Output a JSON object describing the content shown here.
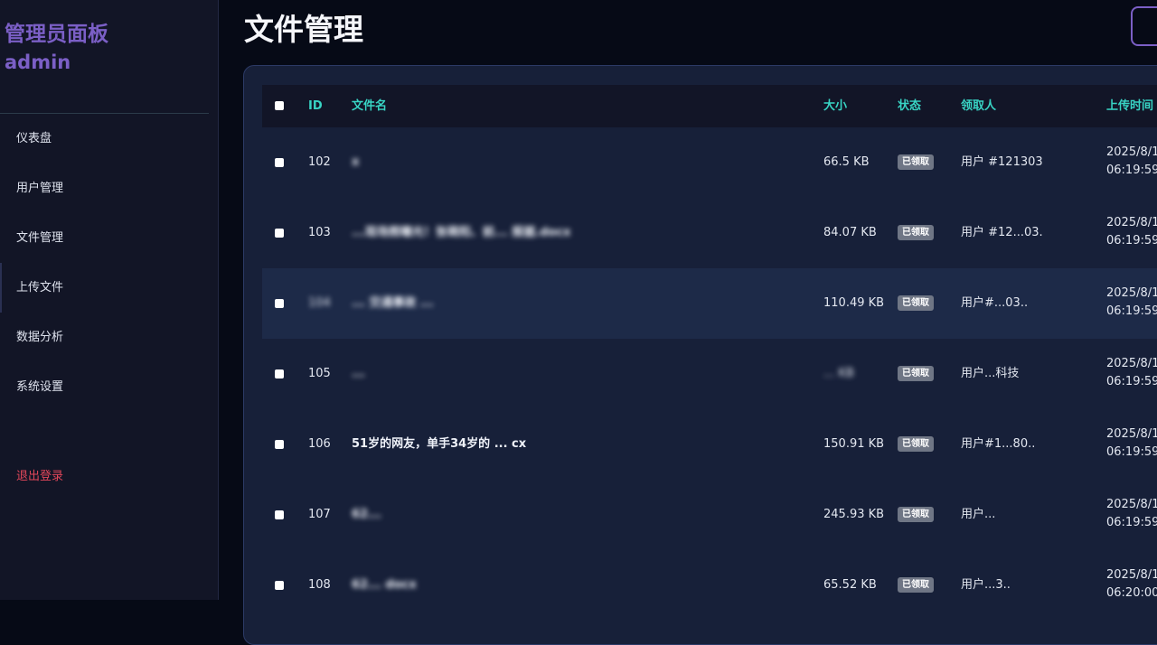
{
  "sidebar": {
    "title": "管理员面板",
    "user": "admin",
    "items": [
      {
        "label": "仪表盘"
      },
      {
        "label": "用户管理"
      },
      {
        "label": "文件管理"
      },
      {
        "label": "上传文件"
      },
      {
        "label": "数据分析"
      },
      {
        "label": "系统设置"
      }
    ],
    "logout": "退出登录"
  },
  "header": {
    "title": "文件管理"
  },
  "table": {
    "columns": {
      "id": "ID",
      "name": "文件名",
      "size": "大小",
      "status": "状态",
      "receiver": "领取人",
      "upload_time": "上传时间"
    },
    "rows": [
      {
        "id": "102",
        "name": "x",
        "size": "66.5 KB",
        "status": "已领取",
        "receiver": "用户 #121303",
        "date": "2025/8/1",
        "time": "06:19:59"
      },
      {
        "id": "103",
        "name": "...现场照曝光！张萌阳、前... 报据.docx",
        "size": "84.07 KB",
        "status": "已领取",
        "receiver": "用户 #12...03..",
        "date": "2025/8/1",
        "time": "06:19:59"
      },
      {
        "id": "104",
        "name": "... 交通事故 ...",
        "size": "110.49 KB",
        "status": "已领取",
        "receiver": "用户#...03..",
        "date": "2025/8/1",
        "time": "06:19:59"
      },
      {
        "id": "105",
        "name": "...",
        "size": "... KB",
        "status": "已领取",
        "receiver": "用户...科技",
        "date": "2025/8/1",
        "time": "06:19:59"
      },
      {
        "id": "106",
        "name": "51岁的网友，单手34岁的 ... cx",
        "size": "150.91 KB",
        "status": "已领取",
        "receiver": "用户#1...80..",
        "date": "2025/8/1",
        "time": "06:19:59"
      },
      {
        "id": "107",
        "name": "62...",
        "size": "245.93 KB",
        "status": "已领取",
        "receiver": "用户...",
        "date": "2025/8/1",
        "time": "06:19:59"
      },
      {
        "id": "108",
        "name": "62... docx",
        "size": "65.52 KB",
        "status": "已领取",
        "receiver": "用户...3..",
        "date": "2025/8/1",
        "time": "06:20:00"
      }
    ]
  },
  "colors": {
    "accent": "#7b5fc6",
    "header_text": "#38d4c4",
    "logout": "#e2475a",
    "badge": "#6f7685"
  }
}
